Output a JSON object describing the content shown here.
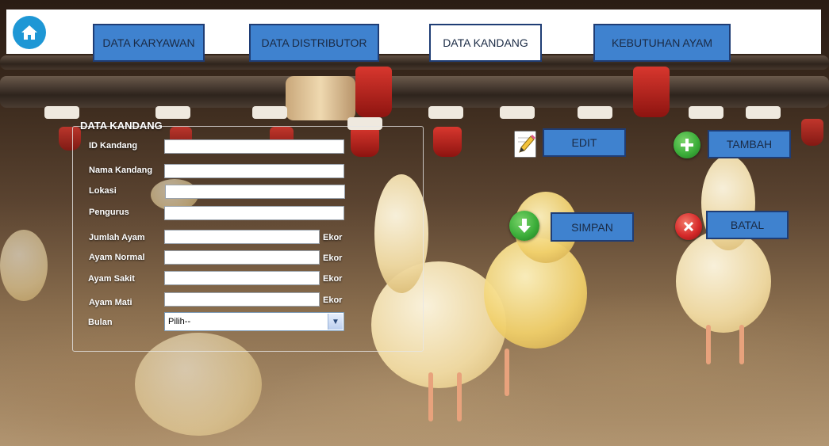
{
  "nav": {
    "home_icon": "home-icon",
    "tabs": [
      {
        "label": "DATA KARYAWAN"
      },
      {
        "label": "DATA DISTRIBUTOR"
      },
      {
        "label": "DATA KANDANG",
        "active": true
      },
      {
        "label": "KEBUTUHAN AYAM"
      }
    ]
  },
  "form": {
    "title": "DATA KANDANG",
    "fields": [
      {
        "label": "ID Kandang",
        "value": ""
      },
      {
        "label": "Nama Kandang",
        "value": ""
      },
      {
        "label": "Lokasi",
        "value": ""
      },
      {
        "label": "Pengurus",
        "value": ""
      },
      {
        "label": "Jumlah Ayam",
        "value": "",
        "unit": "Ekor"
      },
      {
        "label": "Ayam Normal",
        "value": "",
        "unit": "Ekor"
      },
      {
        "label": "Ayam Sakit",
        "value": "",
        "unit": "Ekor"
      },
      {
        "label": "Ayam Mati",
        "value": "",
        "unit": "Ekor"
      }
    ],
    "bulan": {
      "label": "Bulan",
      "selected": "Pilih--"
    }
  },
  "actions": {
    "edit": {
      "label": "EDIT",
      "icon": "edit-icon"
    },
    "tambah": {
      "label": "TAMBAH",
      "icon": "plus-icon"
    },
    "simpan": {
      "label": "SIMPAN",
      "icon": "download-icon"
    },
    "batal": {
      "label": "BATAL",
      "icon": "close-icon"
    }
  },
  "colors": {
    "button_blue": "#3f82cf",
    "button_border": "#1f3d75",
    "home_blue": "#1e97d5",
    "green_icon": "#3cae3a",
    "red_icon": "#d62a2a"
  }
}
